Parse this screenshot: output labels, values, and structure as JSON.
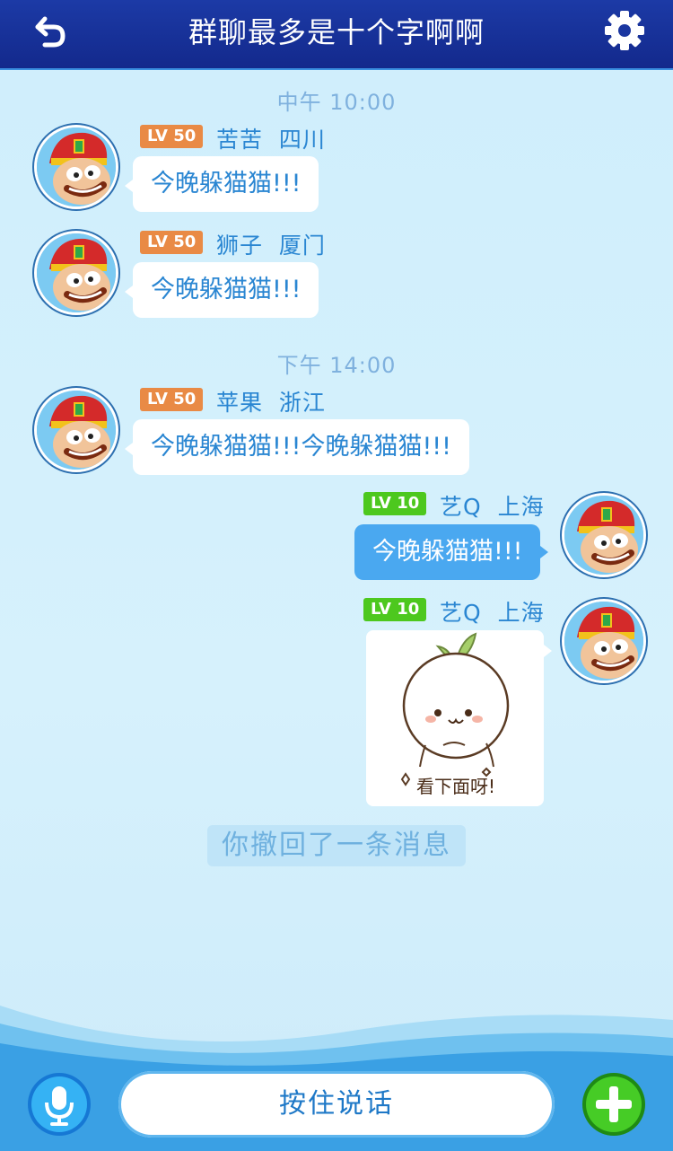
{
  "header": {
    "title": "群聊最多是十个字啊啊",
    "back_icon": "back-arrow-icon",
    "settings_icon": "gear-icon"
  },
  "colors": {
    "header": "#1c3aa6",
    "accent_blue": "#2a86d2",
    "lv_orange": "#e98a45",
    "lv_green": "#4dc81e",
    "my_bubble": "#4aa8f0"
  },
  "messages": {
    "time1": "中午 10:00",
    "time2": "下午 14:00",
    "m1": {
      "level": "LV 50",
      "name": "苦苦",
      "location": "四川",
      "text": "今晚躲猫猫!!!"
    },
    "m2": {
      "level": "LV 50",
      "name": "狮子",
      "location": "厦门",
      "text": "今晚躲猫猫!!!"
    },
    "m3": {
      "level": "LV 50",
      "name": "苹果",
      "location": "浙江",
      "text": "今晚躲猫猫!!!今晚躲猫猫!!!"
    },
    "m4": {
      "level": "LV 10",
      "name": "艺Q",
      "location": "上海",
      "text": "今晚躲猫猫!!!"
    },
    "m5": {
      "level": "LV 10",
      "name": "艺Q",
      "location": "上海",
      "sticker_caption": "看下面呀!"
    },
    "recall_notice": "你撤回了一条消息"
  },
  "footer": {
    "talk_label": "按住说话",
    "mic_icon": "microphone-icon",
    "plus_icon": "plus-icon"
  }
}
